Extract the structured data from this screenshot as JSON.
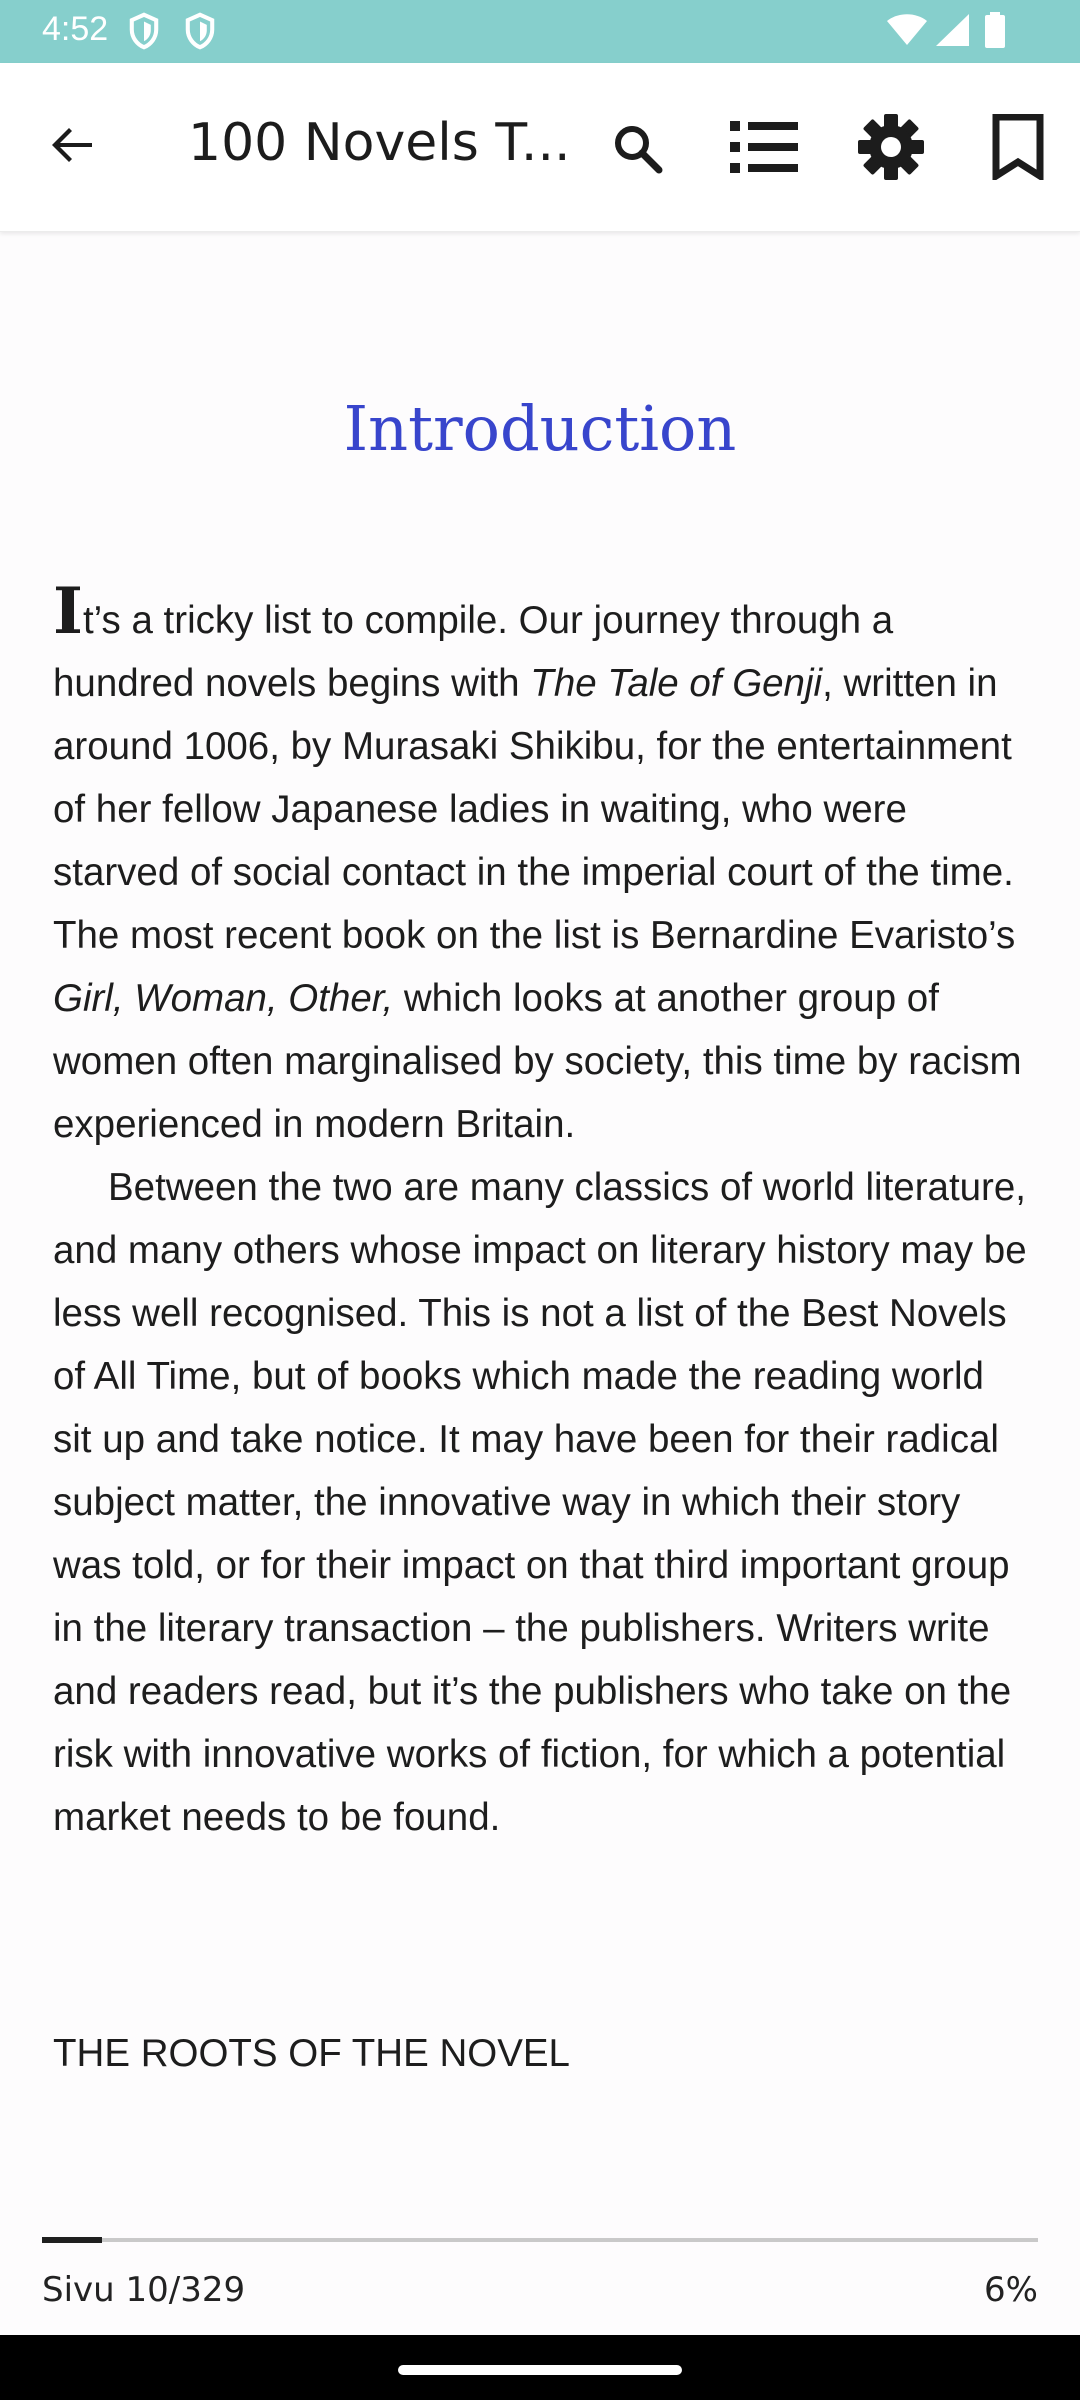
{
  "status_bar": {
    "time": "4:52",
    "icons": [
      "shield-icon",
      "shield-icon",
      "wifi-icon",
      "signal-icon",
      "battery-icon"
    ],
    "background": "#86cfcc"
  },
  "app_bar": {
    "title": "100 Novels T...",
    "actions": [
      "back-arrow-icon",
      "search-icon",
      "list-icon",
      "gear-icon",
      "bookmark-icon"
    ]
  },
  "content": {
    "chapter_title": "Introduction",
    "chapter_title_color": "#3845cc",
    "paragraph1": {
      "drop_cap": "I",
      "text_a": "t’s a tricky list to compile. Our journey through a hundred novels begins with ",
      "italic_a": "The Tale of Genji",
      "text_b": ", written in around 1006, by Murasaki Shikibu, for the entertainment of her fellow Japanese ladies in waiting, who were starved of social contact in the imperial court of the time. The most recent book on the list is Bernardine Evaristo’s ",
      "italic_b": "Girl, Woman, Other,",
      "text_c": " which looks at another group of women often marginalised by society, this time by racism experienced in modern Britain."
    },
    "paragraph2": "Between the two are many classics of world literature, and many others whose impact on literary history may be less well recognised. This is not a list of the Best Novels of All Time, but of books which made the reading world sit up and take notice. It may have been for their radical subject matter, the innovative way in which their story was told, or for their impact on that third important group in the literary transaction – the publishers. Writers write and readers read, but it’s the publishers who take on the risk with innovative works of fiction, for which a potential market needs to be found.",
    "section_heading": "THE ROOTS OF THE NOVEL"
  },
  "footer": {
    "page_label": "Sivu 10/329",
    "percent_label": "6%",
    "progress": 0.06
  }
}
